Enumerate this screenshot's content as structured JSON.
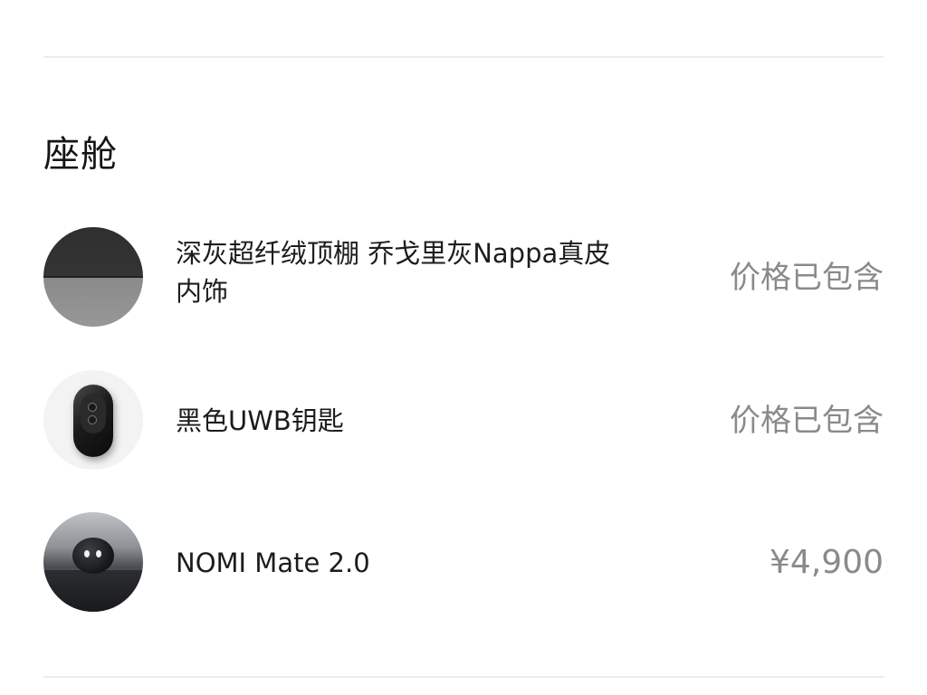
{
  "section": {
    "title": "座舱"
  },
  "items": [
    {
      "label": "深灰超纤绒顶棚 乔戈里灰Nappa真皮内饰",
      "price": "价格已包含",
      "icon": "headliner-interior-swatch-icon"
    },
    {
      "label": "黑色UWB钥匙",
      "price": "价格已包含",
      "icon": "uwb-key-fob-icon"
    },
    {
      "label": "NOMI Mate 2.0",
      "price": "¥4,900",
      "icon": "nomi-mate-device-icon"
    }
  ],
  "colors": {
    "text_primary": "#1c1c1c",
    "text_price": "#8a8a8a",
    "divider": "#ececec",
    "background": "#ffffff"
  }
}
